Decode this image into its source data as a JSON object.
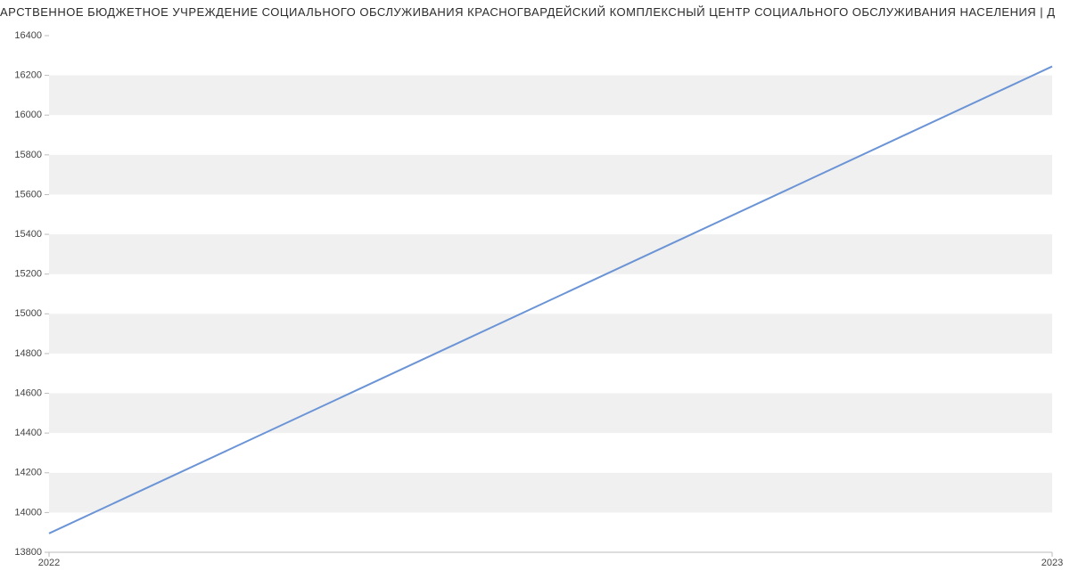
{
  "chart_data": {
    "type": "line",
    "title": "АРСТВЕННОЕ БЮДЖЕТНОЕ УЧРЕЖДЕНИЕ СОЦИАЛЬНОГО ОБСЛУЖИВАНИЯ КРАСНОГВАРДЕЙСКИЙ КОМПЛЕКСНЫЙ ЦЕНТР СОЦИАЛЬНОГО ОБСЛУЖИВАНИЯ НАСЕЛЕНИЯ | Д",
    "x": [
      2022,
      2023
    ],
    "values": [
      13895,
      16245
    ],
    "xlabel": "",
    "ylabel": "",
    "xlim": [
      2022,
      2023
    ],
    "ylim": [
      13800,
      16400
    ],
    "yticks": [
      13800,
      14000,
      14200,
      14400,
      14600,
      14800,
      15000,
      15200,
      15400,
      15600,
      15800,
      16000,
      16200,
      16400
    ],
    "xticks": [
      2022,
      2023
    ],
    "line_color": "#6b94d6",
    "band_color": "#f0f0f0"
  }
}
